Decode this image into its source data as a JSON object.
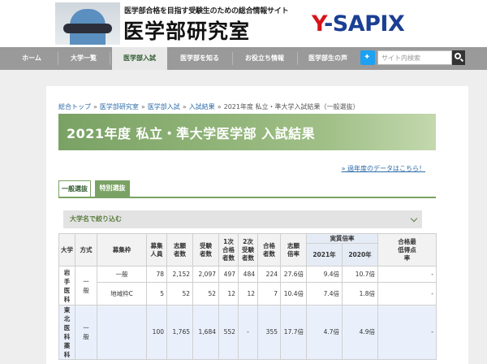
{
  "header": {
    "tagline": "医学部合格を目指す受験生のための総合情報サイト",
    "site_name": "医学部研究室",
    "brand_prefix": "Y",
    "brand_suffix": "-SAPIX"
  },
  "nav": {
    "items": [
      {
        "label": "ホーム",
        "active": false
      },
      {
        "label": "大学一覧",
        "active": false
      },
      {
        "label": "医学部入試",
        "active": true
      },
      {
        "label": "医学部を知る",
        "active": false
      },
      {
        "label": "お役立ち情報",
        "active": false
      },
      {
        "label": "医学部生の声",
        "active": false
      }
    ],
    "search_placeholder": "サイト内検索"
  },
  "breadcrumb": {
    "items": [
      "総合トップ",
      "医学部研究室",
      "医学部入試",
      "入試結果"
    ],
    "current": "2021年度 私立・準大学入試結果（一般選抜）",
    "separator": "»"
  },
  "page_title": "2021年度 私立・準大学医学部 入試結果",
  "past_data_link": "» 過年度のデータはこちら！",
  "tabs": [
    {
      "label": "一般選抜",
      "active": true
    },
    {
      "label": "特別選抜",
      "active": false
    }
  ],
  "filter": {
    "label": "大学名で絞り込む"
  },
  "table": {
    "headers": {
      "university": "大学",
      "method": "方式",
      "quota_frame": "募集枠",
      "capacity": "募集人員",
      "applicants": "志願者数",
      "examinees": "受験者数",
      "first_pass": "1次合格者数",
      "second_examinees": "2次受験者数",
      "passers": "合格者数",
      "app_ratio": "志願倍率",
      "actual_ratio": "実質倍率",
      "y2021": "2021年",
      "y2020": "2020年",
      "min_score": "合格最低得点率"
    },
    "groups": [
      {
        "university": "岩手医科",
        "method": "一般",
        "rows": [
          {
            "frame": "一般",
            "capacity": "78",
            "applicants": "2,152",
            "examinees": "2,097",
            "first_pass": "497",
            "second": "484",
            "passers": "224",
            "app_ratio": "27.6倍",
            "r2021": "9.4倍",
            "r2020": "10.7倍",
            "min": "-"
          },
          {
            "frame": "地域枠C",
            "capacity": "5",
            "applicants": "52",
            "examinees": "52",
            "first_pass": "12",
            "second": "12",
            "passers": "7",
            "app_ratio": "10.4倍",
            "r2021": "7.4倍",
            "r2020": "1.8倍",
            "min": "-"
          }
        ]
      },
      {
        "university": "東北医科薬科",
        "method": "一般",
        "rows": [
          {
            "frame": "",
            "capacity": "100",
            "applicants": "1,765",
            "examinees": "1,684",
            "first_pass": "552",
            "second": "-",
            "passers": "355",
            "app_ratio": "17.7倍",
            "r2021": "4.7倍",
            "r2020": "4.9倍",
            "min": "-"
          }
        ]
      }
    ]
  }
}
